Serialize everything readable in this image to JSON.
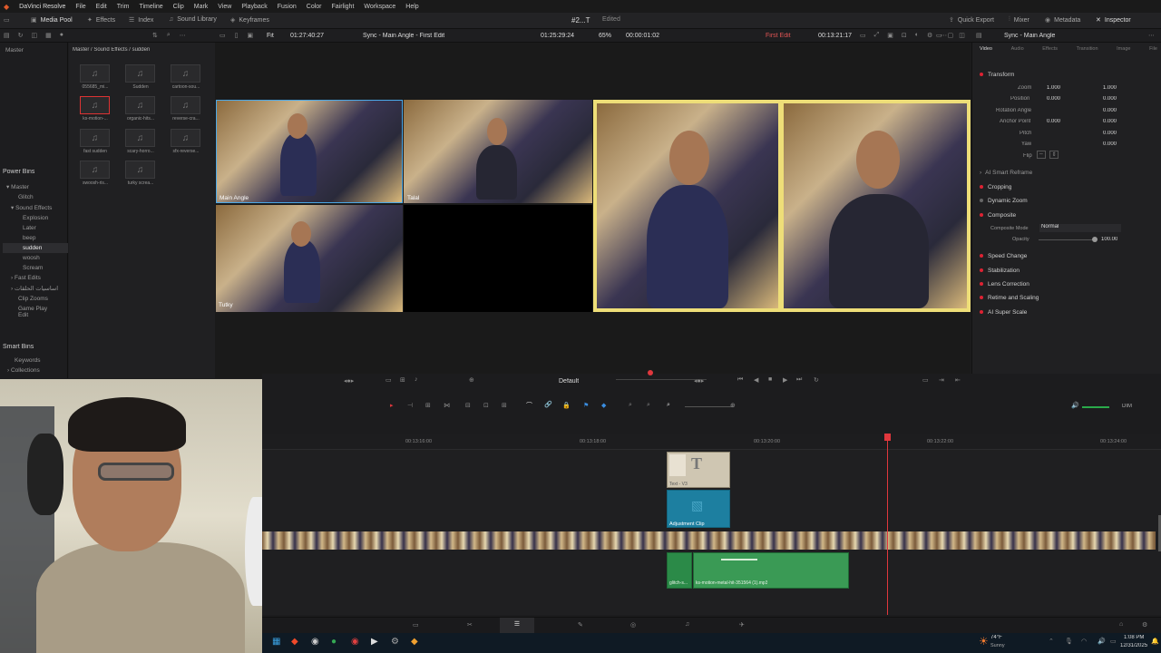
{
  "menubar": {
    "app": "DaVinci Resolve",
    "items": [
      "File",
      "Edit",
      "Trim",
      "Timeline",
      "Clip",
      "Mark",
      "View",
      "Playback",
      "Fusion",
      "Color",
      "Fairlight",
      "Workspace",
      "Help"
    ],
    "project": "#2...T",
    "status": "Edited"
  },
  "toolbar": {
    "media_pool": "Media Pool",
    "effects": "Effects",
    "index": "Index",
    "sound_library": "Sound Library",
    "keyframes": "Keyframes",
    "quick_export": "Quick Export",
    "mixer": "Mixer",
    "metadata": "Metadata",
    "inspector": "Inspector"
  },
  "viewer_bar": {
    "fit": "Fit",
    "source_tc": "01:27:40:27",
    "source_title": "Sync - Main Angle - First Edit",
    "program_tc": "01:25:29:24",
    "zoom": "65%",
    "duration": "00:00:01:02",
    "edit_name": "First Edit",
    "timeline_tc": "00:13:21:17",
    "inspector_title": "Sync - Main Angle"
  },
  "sidebar": {
    "master": "Master",
    "power_bins": "Power Bins",
    "items": [
      "Master",
      "Glitch",
      "Sound Effects",
      "Explosion",
      "Later",
      "beep",
      "sudden",
      "woosh",
      "Scream",
      "Fast Edits",
      "اساسيات الحلقات",
      "Clip Zooms",
      "Game Play Edit"
    ],
    "smart_bins": "Smart Bins",
    "smart_items": [
      "Keywords",
      "Collections"
    ]
  },
  "media_pool": {
    "path": "Master / Sound Effects / sudden",
    "clips": [
      "055685_mi...",
      "Sudden",
      "cartoon-sou...",
      "ks-motion-...",
      "organic-hits...",
      "reverse-cra...",
      "fast sudden",
      "scary-horro...",
      "sfx-reverse...",
      "swoosh-ris...",
      "turky screa..."
    ]
  },
  "multicam": {
    "angles": [
      "Main Angle",
      "Talal",
      "Tutky"
    ]
  },
  "inspector": {
    "tabs": [
      "Video",
      "Audio",
      "Effects",
      "Transition",
      "Image",
      "File"
    ],
    "transform": "Transform",
    "zoom_label": "Zoom",
    "zoom_x": "1.000",
    "zoom_y": "1.000",
    "position_label": "Position",
    "position_x": "0.000",
    "position_y": "0.000",
    "rotation_label": "Rotation Angle",
    "rotation_val": "0.000",
    "anchor_label": "Anchor Point",
    "anchor_x": "0.000",
    "anchor_y": "0.000",
    "pitch_label": "Pitch",
    "pitch_val": "0.000",
    "yaw_label": "Yaw",
    "yaw_val": "0.000",
    "flip_label": "Flip",
    "sections": [
      "AI Smart Reframe",
      "Cropping",
      "Dynamic Zoom",
      "Composite",
      "Speed Change",
      "Stabilization",
      "Lens Correction",
      "Retime and Scaling",
      "AI Super Scale"
    ],
    "composite_mode_label": "Composite Mode",
    "composite_mode": "Normal",
    "opacity_label": "Opacity",
    "opacity": "100.00"
  },
  "transport": {
    "default_label": "Default",
    "dim": "DIM"
  },
  "timeline": {
    "ruler": [
      "00:13:16:00",
      "00:13:18:00",
      "00:13:20:00",
      "00:13:22:00",
      "00:13:24:00"
    ],
    "title_clip": "Text - V3",
    "adjustment_clip": "Adjustment Clip",
    "audio_clip_a": "glitch-s...",
    "audio_clip_b": "ks-motion-metal-hit-351564 (1).mp3"
  },
  "taskbar": {
    "weather_temp": "74°F",
    "weather_desc": "Sunny",
    "time": "1:08 PM",
    "date": "12/31/2025"
  }
}
